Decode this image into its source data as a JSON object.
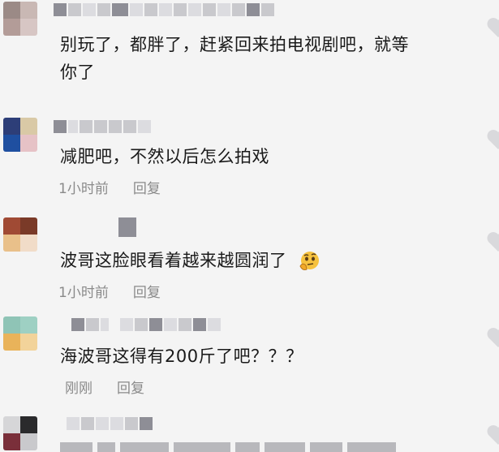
{
  "comments": [
    {
      "text_line1": "别玩了，都胖了，赶紧回来拍电视剧吧，就等",
      "text_line2": "你了"
    },
    {
      "text": "减肥吧，不然以后怎么拍戏",
      "time": "1小时前",
      "reply": "回复"
    },
    {
      "text": "波哥这脸眼看着越来越圆润了",
      "emoji": "thinking-face-emoji",
      "time": "1小时前",
      "reply": "回复"
    },
    {
      "text": "海波哥这得有200斤了吧？？？",
      "time": "刚刚",
      "reply": "回复"
    }
  ],
  "icons": {
    "like": "heart-icon",
    "avatar": "blurred-avatar"
  },
  "colors": {
    "background": "#f4f4f4",
    "text": "#1a1a1a",
    "meta": "#8a8a8a",
    "heart": "#d9d9dc"
  }
}
